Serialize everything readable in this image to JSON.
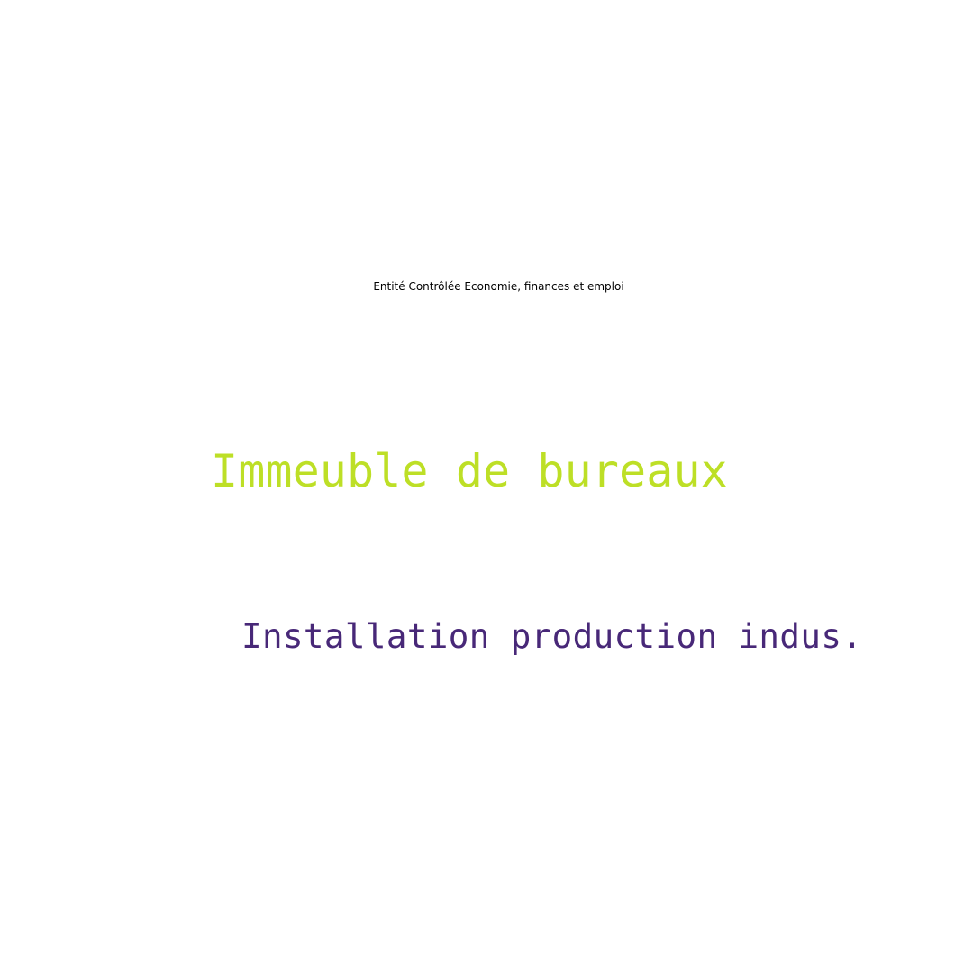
{
  "title": "Entité Contrôlée Economie, finances et emploi",
  "words": [
    {
      "text": "Immeuble de bureaux",
      "color": "#bddf26"
    },
    {
      "text": "Installation production indus.",
      "color": "#482878"
    }
  ]
}
